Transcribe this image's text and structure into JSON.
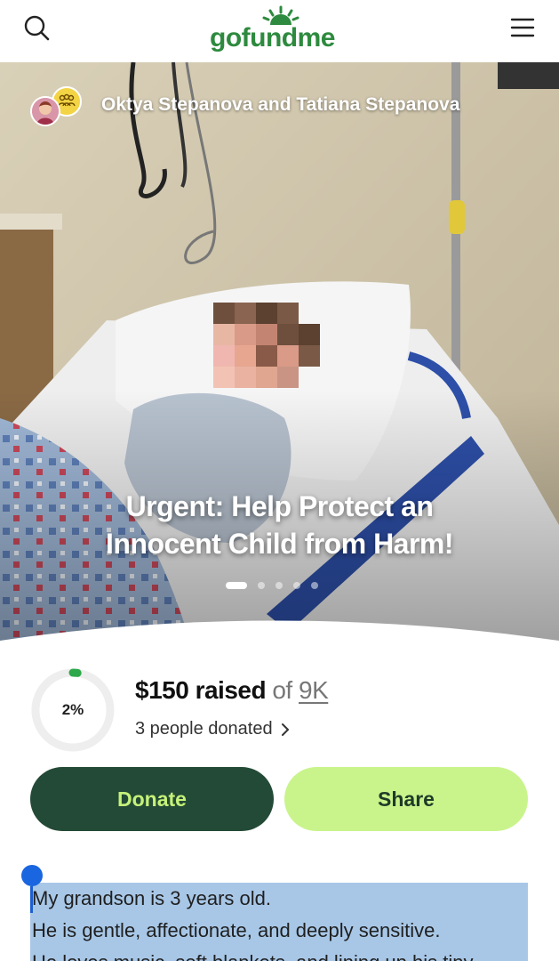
{
  "header": {
    "logo_text": "gofundme",
    "icons": [
      "search-icon",
      "hamburger-menu-icon"
    ]
  },
  "hero": {
    "organizer": "Oktya Stepanova and Tatiana Stepanova",
    "title_line1": "Urgent: Help Protect an",
    "title_line2": "Innocent Child from Harm!",
    "carousel_active_index": 0,
    "carousel_count": 5
  },
  "progress": {
    "percent_label": "2%",
    "percent_value": 0.02,
    "raised": "$150 raised",
    "of": "of",
    "goal": "9K",
    "donors": "3 people donated"
  },
  "buttons": {
    "donate": "Donate",
    "share": "Share"
  },
  "story": {
    "lines": [
      "My grandson is 3 years old.",
      "He is gentle, affectionate, and deeply sensitive.",
      "He loves music, soft blankets, and lining up his tiny"
    ]
  },
  "colors": {
    "brand_green": "#2d8a3e",
    "donate_bg": "#234a36",
    "donate_text": "#c6f27a",
    "share_bg": "#c9f48c",
    "selection": "#a8c7e7"
  }
}
